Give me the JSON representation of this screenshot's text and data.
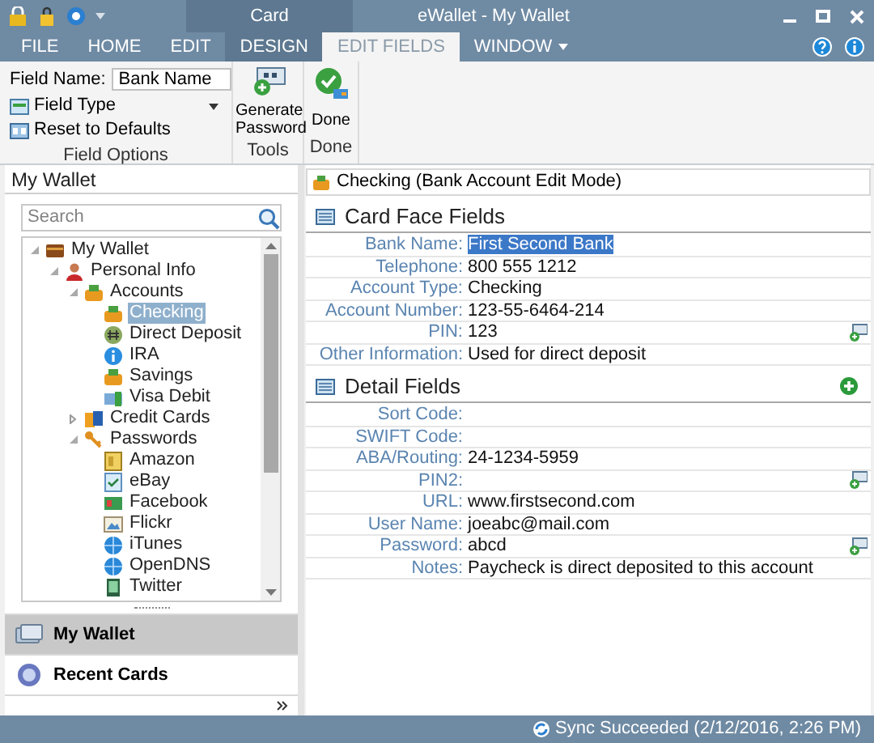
{
  "window": {
    "title": "eWallet - My Wallet",
    "context_group": "Card"
  },
  "tabs": [
    {
      "label": "FILE",
      "selected": false,
      "contextual": false
    },
    {
      "label": "HOME",
      "selected": false,
      "contextual": false
    },
    {
      "label": "EDIT",
      "selected": false,
      "contextual": false
    },
    {
      "label": "DESIGN",
      "selected": false,
      "contextual": true
    },
    {
      "label": "EDIT FIELDS",
      "selected": true,
      "contextual": true
    },
    {
      "label": "WINDOW",
      "selected": false,
      "contextual": false,
      "dropdown": true
    }
  ],
  "ribbon": {
    "field_options": {
      "field_name_label": "Field Name:",
      "field_name_value": "Bank Name",
      "field_type": "Field Type",
      "reset": "Reset to Defaults",
      "group_label": "Field Options"
    },
    "tools": {
      "button": "Generate Password",
      "group_label": "Tools"
    },
    "done": {
      "button": "Done",
      "group_label": "Done"
    }
  },
  "sidebar": {
    "title": "My Wallet",
    "search": {
      "placeholder": "Search"
    },
    "tree": [
      {
        "label": "My Wallet",
        "kind": "wallet",
        "expanded": true,
        "selected": false,
        "children": [
          {
            "label": "Personal Info",
            "kind": "person",
            "expanded": true,
            "selected": false,
            "children": [
              {
                "label": "Accounts",
                "kind": "account",
                "expanded": true,
                "selected": false,
                "children": [
                  {
                    "label": "Checking",
                    "kind": "account",
                    "selected": true
                  },
                  {
                    "label": "Direct Deposit",
                    "kind": "deposit",
                    "selected": false
                  },
                  {
                    "label": "IRA",
                    "kind": "info",
                    "selected": false
                  },
                  {
                    "label": "Savings",
                    "kind": "account",
                    "selected": false
                  },
                  {
                    "label": "Visa Debit",
                    "kind": "card",
                    "selected": false
                  }
                ]
              },
              {
                "label": "Credit Cards",
                "kind": "cards",
                "expanded": false,
                "selected": false
              },
              {
                "label": "Passwords",
                "kind": "key",
                "expanded": true,
                "selected": false,
                "children": [
                  {
                    "label": "Amazon",
                    "kind": "note",
                    "selected": false
                  },
                  {
                    "label": "eBay",
                    "kind": "check",
                    "selected": false
                  },
                  {
                    "label": "Facebook",
                    "kind": "site",
                    "selected": false
                  },
                  {
                    "label": "Flickr",
                    "kind": "photo",
                    "selected": false
                  },
                  {
                    "label": "iTunes",
                    "kind": "globe",
                    "selected": false
                  },
                  {
                    "label": "OpenDNS",
                    "kind": "globe",
                    "selected": false
                  },
                  {
                    "label": "Twitter",
                    "kind": "phone",
                    "selected": false
                  }
                ]
              }
            ]
          }
        ]
      }
    ],
    "nav": [
      {
        "label": "My Wallet",
        "selected": true
      },
      {
        "label": "Recent Cards",
        "selected": false
      }
    ]
  },
  "card": {
    "header": "Checking (Bank Account Edit Mode)",
    "sections": [
      {
        "title": "Card Face Fields",
        "fields": [
          {
            "label": "Bank Name:",
            "value": "First Second Bank",
            "selected": true
          },
          {
            "label": "Telephone:",
            "value": "800 555 1212",
            "selected": false
          },
          {
            "label": "Account Type:",
            "value": "Checking",
            "selected": false
          },
          {
            "label": "Account Number:",
            "value": "123-55-6464-214",
            "selected": false
          },
          {
            "label": "PIN:",
            "value": "123",
            "selected": false,
            "generator": true
          },
          {
            "label": "Other Information:",
            "value": "Used for direct deposit",
            "selected": false
          }
        ]
      },
      {
        "title": "Detail Fields",
        "add_button": true,
        "fields": [
          {
            "label": "Sort Code:",
            "selected": false
          },
          {
            "label": "SWIFT Code:",
            "selected": false
          },
          {
            "label": "ABA/Routing:",
            "value": "24-1234-5959",
            "selected": false
          },
          {
            "label": "PIN2:",
            "selected": false,
            "generator": true
          },
          {
            "label": "URL:",
            "value": "www.firstsecond.com",
            "selected": false
          },
          {
            "label": "User Name:",
            "value": "joeabc@mail.com",
            "selected": false
          },
          {
            "label": "Password:",
            "value": "abcd",
            "selected": false,
            "generator": true
          },
          {
            "label": "Notes:",
            "value": "Paycheck is direct deposited to this account",
            "selected": false
          }
        ]
      }
    ]
  },
  "status_bar": {
    "text": "Sync Succeeded (2/12/2016, 2:26 PM)"
  }
}
